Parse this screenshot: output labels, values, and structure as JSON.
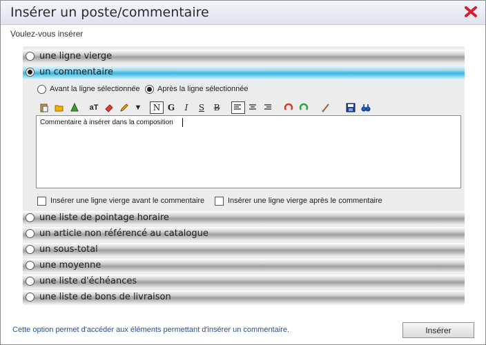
{
  "window": {
    "title": "Insérer un poste/commentaire"
  },
  "prompt": "Voulez-vous insérer",
  "options": [
    {
      "label": "une ligne vierge",
      "selected": false
    },
    {
      "label": "un commentaire",
      "selected": true
    },
    {
      "label": "une liste de pointage horaire",
      "selected": false
    },
    {
      "label": "un article non référencé au catalogue",
      "selected": false
    },
    {
      "label": "un sous-total",
      "selected": false
    },
    {
      "label": "une moyenne",
      "selected": false
    },
    {
      "label": "une liste d'échéances",
      "selected": false
    },
    {
      "label": "une liste de bons de livraison",
      "selected": false
    }
  ],
  "position": {
    "before": "Avant la ligne sélectionnée",
    "after": "Après la ligne sélectionnée",
    "selected": "after"
  },
  "toolbar": {
    "normal": "N",
    "bold": "G",
    "italic": "I",
    "underline": "S",
    "strike": "B"
  },
  "editor": {
    "value": "Commentaire à insérer dans la composition"
  },
  "checkboxes": {
    "before": "Insérer une ligne vierge avant le commentaire",
    "after": "Insérer une ligne vierge après le commentaire"
  },
  "status": "Cette option permet d'accéder aux éléments permettant d'insérer un commentaire.",
  "button": {
    "insert": "Insérer"
  },
  "colors": {
    "selected_row": "#37b5dd",
    "close_icon": "#d61f2f",
    "status_text": "#2c4f97"
  }
}
